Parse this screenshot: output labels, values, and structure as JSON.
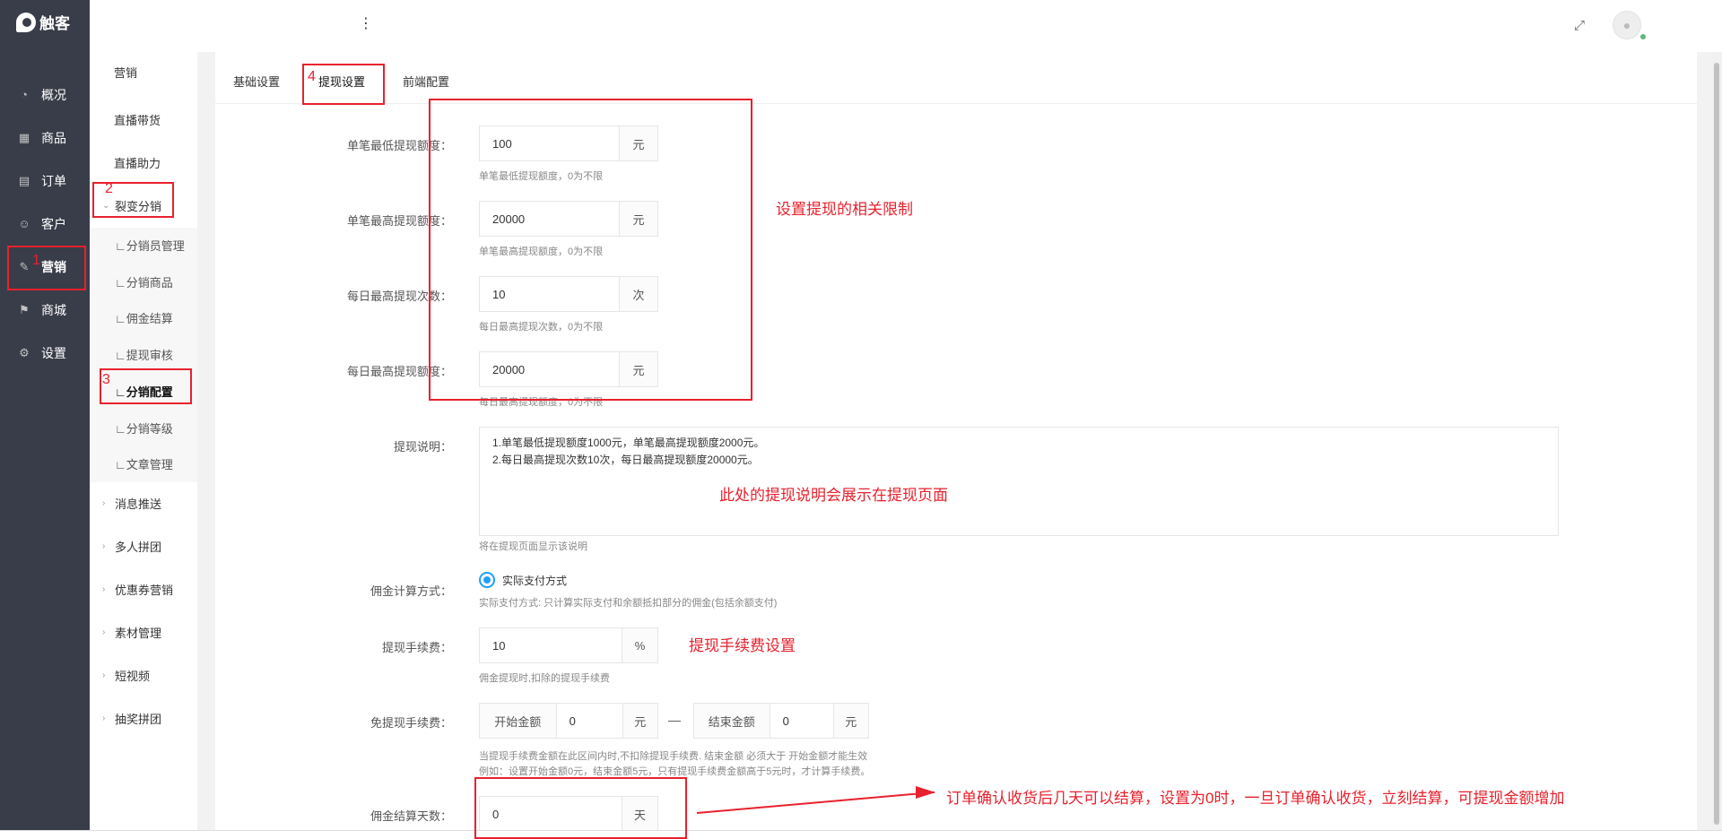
{
  "app": {
    "logo_text": "触客"
  },
  "sidebar": {
    "items": [
      {
        "label": "概况",
        "icon": "gauge-icon"
      },
      {
        "label": "商品",
        "icon": "grid-icon"
      },
      {
        "label": "订单",
        "icon": "calendar-icon"
      },
      {
        "label": "客户",
        "icon": "user-icon"
      },
      {
        "label": "营销",
        "icon": "tag-icon"
      },
      {
        "label": "商城",
        "icon": "signpost-icon"
      },
      {
        "label": "设置",
        "icon": "gear-icon"
      }
    ]
  },
  "subnav": {
    "items": [
      "营销",
      "直播带货",
      "直播助力"
    ],
    "group": "裂变分销",
    "children": [
      "∟分销员管理",
      "∟分销商品",
      "∟佣金结算",
      "∟提现审核",
      "∟分销配置",
      "∟分销等级",
      "∟文章管理"
    ],
    "more": [
      "消息推送",
      "多人拼团",
      "优惠券营销",
      "素材管理",
      "短视频",
      "抽奖拼团"
    ]
  },
  "tabs": [
    "基础设置",
    "提现设置",
    "前端配置"
  ],
  "form": {
    "min_single": {
      "label": "单笔最低提现额度：",
      "value": "100",
      "unit": "元",
      "hint": "单笔最低提现额度，0为不限"
    },
    "max_single": {
      "label": "单笔最高提现额度：",
      "value": "20000",
      "unit": "元",
      "hint": "单笔最高提现额度，0为不限"
    },
    "daily_count": {
      "label": "每日最高提现次数：",
      "value": "10",
      "unit": "次",
      "hint": "每日最高提现次数，0为不限"
    },
    "daily_amount": {
      "label": "每日最高提现额度：",
      "value": "20000",
      "unit": "元",
      "hint": "每日最高提现额度，0为不限"
    },
    "description": {
      "label": "提现说明：",
      "line1": "1.单笔最低提现额度1000元，单笔最高提现额度2000元。",
      "line2": "2.每日最高提现次数10次，每日最高提现额度20000元。",
      "hint": "将在提现页面显示该说明"
    },
    "commission_mode": {
      "label": "佣金计算方式：",
      "option": "实际支付方式",
      "hint": "实际支付方式: 只计算实际支付和余额抵扣部分的佣金(包括余额支付)"
    },
    "fee": {
      "label": "提现手续费：",
      "value": "10",
      "unit": "%",
      "hint": "佣金提现时,扣除的提现手续费"
    },
    "free_fee": {
      "label": "免提现手续费：",
      "start_label": "开始金额",
      "start_value": "0",
      "start_unit": "元",
      "dash": "—",
      "end_label": "结束金额",
      "end_value": "0",
      "end_unit": "元",
      "hint1": "当提现手续费金额在此区间内时,不扣除提现手续费. 结束金额 必须大于 开始金额才能生效",
      "hint2": "例如：设置开始金额0元，结束金额5元，只有提现手续费金额高于5元时，才计算手续费。"
    },
    "settle_days": {
      "label": "佣金结算天数：",
      "value": "0",
      "unit": "天"
    }
  },
  "annotations": {
    "n1": "1",
    "n2": "2",
    "n3": "3",
    "n4": "4",
    "limits": "设置提现的相关限制",
    "desc": "此处的提现说明会展示在提现页面",
    "fee": "提现手续费设置",
    "settle": "订单确认收货后几天可以结算，设置为0时，一旦订单确认收货，立刻结算，可提现金额增加"
  }
}
